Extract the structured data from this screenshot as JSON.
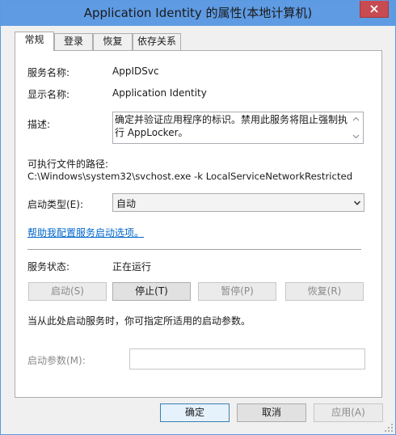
{
  "window": {
    "title": "Application Identity 的属性(本地计算机)",
    "close_symbol": "×"
  },
  "tabs": [
    {
      "label": "常规",
      "active": true
    },
    {
      "label": "登录",
      "active": false
    },
    {
      "label": "恢复",
      "active": false
    },
    {
      "label": "依存关系",
      "active": false
    }
  ],
  "general": {
    "service_name_label": "服务名称:",
    "service_name_value": "AppIDSvc",
    "display_name_label": "显示名称:",
    "display_name_value": "Application Identity",
    "description_label": "描述:",
    "description_value": "确定并验证应用程序的标识。禁用此服务将阻止强制执行 AppLocker。",
    "path_label": "可执行文件的路径:",
    "path_value": "C:\\Windows\\system32\\svchost.exe -k LocalServiceNetworkRestricted",
    "startup_type_label": "启动类型(E):",
    "startup_type_value": "自动",
    "help_link": "帮助我配置服务启动选项。",
    "status_label": "服务状态:",
    "status_value": "正在运行",
    "start_button": "启动(S)",
    "stop_button": "停止(T)",
    "pause_button": "暂停(P)",
    "resume_button": "恢复(R)",
    "hint_text": "当从此处启动服务时，你可指定所适用的启动参数。",
    "start_params_label": "启动参数(M):",
    "start_params_value": ""
  },
  "footer": {
    "ok_button": "确定",
    "cancel_button": "取消",
    "apply_button": "应用(A)"
  },
  "colors": {
    "titlebar": "#5f9be3",
    "close_button": "#c74b50",
    "link": "#0066cc"
  },
  "icons": {
    "close": "close-icon",
    "dropdown": "chevron-down-icon",
    "scroll_up": "scroll-up-icon",
    "scroll_down": "scroll-down-icon"
  }
}
